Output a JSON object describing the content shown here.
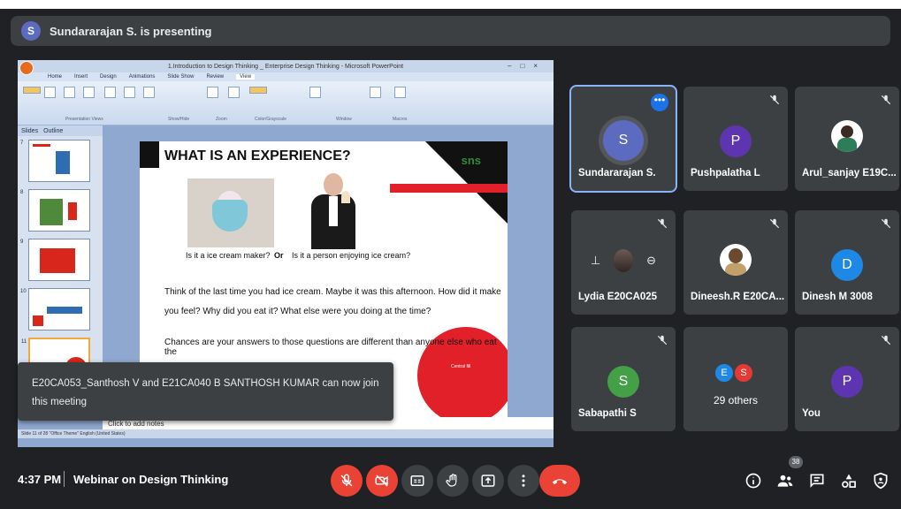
{
  "banner": {
    "avatar_letter": "S",
    "text": "Sundararajan S. is presenting",
    "avatar_color": "#5c6bc0"
  },
  "ppt": {
    "window_title": "1.Introduction to Design Thinking _ Enterprise Design Thinking - Microsoft PowerPoint",
    "tabs": [
      "Home",
      "Insert",
      "Design",
      "Animations",
      "Slide Show",
      "Review",
      "View"
    ],
    "ribbon_groups": [
      "Presentation Views",
      "Show/Hide",
      "Zoom",
      "Color/Grayscale",
      "Window",
      "Macros"
    ],
    "panel_tabs": [
      "Slides",
      "Outline"
    ],
    "thumb_numbers": [
      "7",
      "8",
      "9",
      "10",
      "11"
    ],
    "status": "Slide 11 of 28   \"Office Theme\"   English (United States)",
    "notes_placeholder": "Click to add notes"
  },
  "slide": {
    "heading": "WHAT IS AN EXPERIENCE?",
    "logo": "sns",
    "q1": "Is it a ice cream maker?",
    "or": "Or",
    "q2": "Is it a person enjoying ice cream?",
    "para1": "Think of the last time you had ice cream. Maybe it was this afternoon. How did it make you feel? Why did you eat it? What else were you doing at the time?",
    "para2": "Chances are your answers to those questions are different than anyone else who eat the",
    "circle_text": "Central fill"
  },
  "toast": {
    "text": "E20CA053_Santhosh V and E21CA040 B SANTHOSH KUMAR can now join this meeting"
  },
  "tiles": [
    {
      "name": "Sundararajan S.",
      "letter": "S",
      "color": "#5c6bc0",
      "type": "avatar-big"
    },
    {
      "name": "Pushpalatha L",
      "letter": "P",
      "color": "#5e35b1",
      "type": "avatar"
    },
    {
      "name": "Arul_sanjay E19C...",
      "letter": "",
      "color": "#ffffff",
      "type": "photo"
    },
    {
      "name": "Lydia E20CA025",
      "letter": "",
      "color": "#9e9e9e",
      "type": "hover"
    },
    {
      "name": "Dineesh.R E20CA...",
      "letter": "",
      "color": "#ffffff",
      "type": "photo"
    },
    {
      "name": "Dinesh M 3008",
      "letter": "D",
      "color": "#1e88e5",
      "type": "avatar"
    },
    {
      "name": "Sabapathi S",
      "letter": "S",
      "color": "#43a047",
      "type": "avatar"
    },
    {
      "name": "29 others",
      "letter_a": "E",
      "letter_b": "S",
      "color_a": "#1e88e5",
      "color_b": "#e53935",
      "type": "others"
    },
    {
      "name": "You",
      "letter": "P",
      "color": "#5e35b1",
      "type": "avatar"
    }
  ],
  "bottom": {
    "time": "4:37 PM",
    "meeting": "Webinar on Design Thinking",
    "participants_count": "38"
  }
}
